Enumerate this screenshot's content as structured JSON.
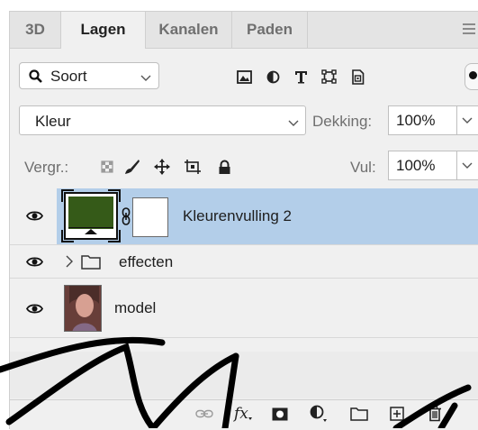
{
  "tabs": [
    {
      "label": "3D",
      "active": false
    },
    {
      "label": "Lagen",
      "active": true
    },
    {
      "label": "Kanalen",
      "active": false
    },
    {
      "label": "Paden",
      "active": false
    }
  ],
  "filter": {
    "label": "Soort",
    "icons": [
      "image-filter-icon",
      "adjustment-filter-icon",
      "text-filter-icon",
      "shape-filter-icon",
      "smart-object-filter-icon"
    ]
  },
  "blend": {
    "mode": "Kleur",
    "opacity_label": "Dekking:",
    "opacity_value": "100%"
  },
  "lock": {
    "label": "Vergr.:",
    "fill_label": "Vul:",
    "fill_value": "100%"
  },
  "layers": [
    {
      "name": "Kleurenvulling 2",
      "type": "fill",
      "selected": true,
      "visible": true,
      "fill_color": "#355a18"
    },
    {
      "name": "effecten",
      "type": "group",
      "selected": false,
      "visible": true
    },
    {
      "name": "model",
      "type": "image",
      "selected": false,
      "visible": true
    }
  ],
  "colors": {
    "selection": "#b3cee9",
    "panel": "#f0f0f0",
    "watermark": "#000000"
  }
}
